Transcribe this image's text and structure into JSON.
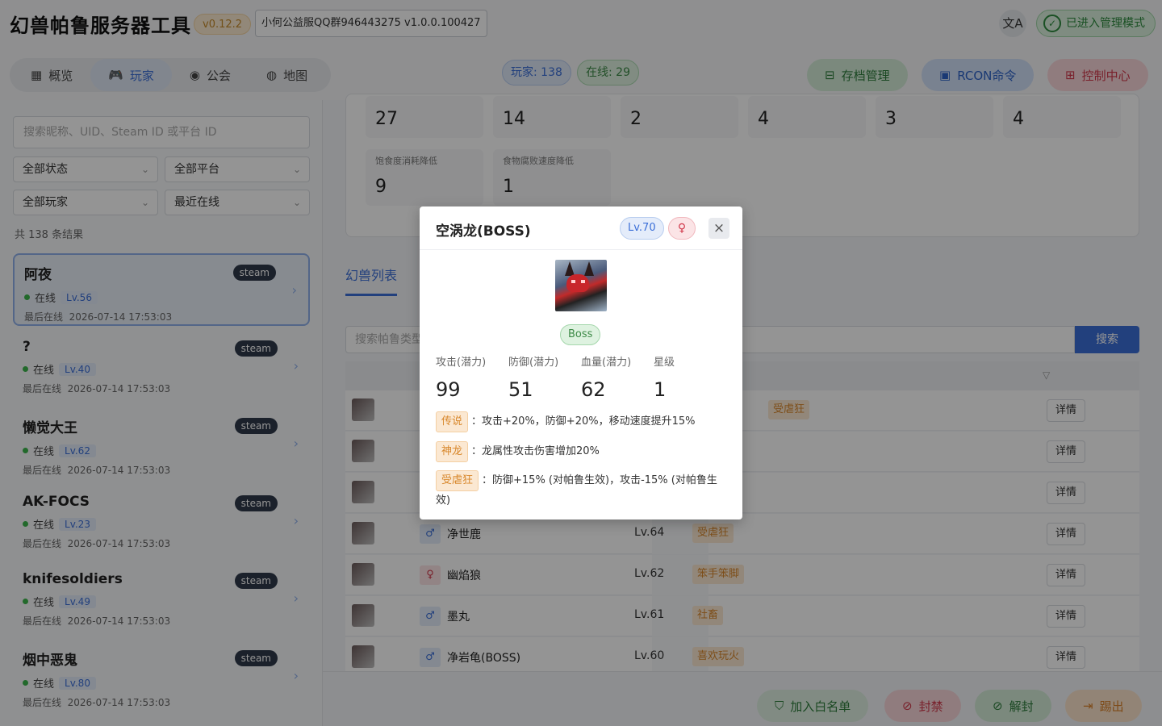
{
  "app": {
    "title": "幻兽帕鲁服务器工具",
    "version": "v0.12.2",
    "group_tag": "小何公益服QQ群946443275 v1.0.0.100427",
    "translate_glyph": "文A",
    "admin_mode": "已进入管理模式"
  },
  "nav": {
    "tabs": [
      {
        "icon": "▦",
        "label": "概览"
      },
      {
        "icon": "🎮",
        "label": "玩家"
      },
      {
        "icon": "◉",
        "label": "公会"
      },
      {
        "icon": "◍",
        "label": "地图"
      }
    ],
    "active_tab": "玩家"
  },
  "stats": {
    "players": "玩家: 138",
    "online": "在线: 29"
  },
  "toolbar": {
    "save": "存档管理",
    "rcon": "RCON命令",
    "control": "控制中心"
  },
  "sidebar": {
    "search_placeholder": "搜索昵称、UID、Steam ID 或平台 ID",
    "filters": {
      "status": "全部状态",
      "platform": "全部平台",
      "players": "全部玩家",
      "sort": "最近在线"
    },
    "result_count": "共 138 条结果",
    "players": [
      {
        "name": "阿夜",
        "platform": "steam",
        "status": "在线",
        "level": "Lv.56",
        "last_label": "最后在线",
        "last": "2026-07-14 17:53:03"
      },
      {
        "name": "?",
        "platform": "steam",
        "status": "在线",
        "level": "Lv.40",
        "last_label": "最后在线",
        "last": "2026-07-14 17:53:03"
      },
      {
        "name": "懒觉大王",
        "platform": "steam",
        "status": "在线",
        "level": "Lv.62",
        "last_label": "最后在线",
        "last": "2026-07-14 17:53:03"
      },
      {
        "name": "AK-FOCS",
        "platform": "steam",
        "status": "在线",
        "level": "Lv.23",
        "last_label": "最后在线",
        "last": "2026-07-14 17:53:03"
      },
      {
        "name": "knifesoldiers",
        "platform": "steam",
        "status": "在线",
        "level": "Lv.49",
        "last_label": "最后在线",
        "last": "2026-07-14 17:53:03"
      },
      {
        "name": "烟中恶鬼",
        "platform": "steam",
        "status": "在线",
        "level": "Lv.80",
        "last_label": "最后在线",
        "last": "2026-07-14 17:53:03"
      }
    ]
  },
  "main": {
    "stat_values": [
      "27",
      "14",
      "2",
      "4",
      "3",
      "4"
    ],
    "stat_cells2": [
      {
        "label": "饱食度消耗降低",
        "value": "9"
      },
      {
        "label": "食物腐败速度降低",
        "value": "1"
      }
    ],
    "tab_label": "幻兽列表",
    "pal_search_placeholder": "搜索帕鲁类型",
    "search_button": "搜索",
    "rows": [
      {
        "gender": "",
        "name": "",
        "level": "",
        "trait": "受虐狂",
        "detail": "详情"
      },
      {
        "gender": "",
        "name": "",
        "level": "",
        "trait": "",
        "detail": "详情"
      },
      {
        "gender": "",
        "name": "",
        "level": "",
        "trait": "",
        "detail": "详情"
      },
      {
        "gender": "♂",
        "name": "净世鹿",
        "level": "Lv.64",
        "trait": "受虐狂",
        "detail": "详情"
      },
      {
        "gender": "♀",
        "name": "幽焰狼",
        "level": "Lv.62",
        "trait": "笨手笨脚",
        "detail": "详情"
      },
      {
        "gender": "♂",
        "name": "墨丸",
        "level": "Lv.61",
        "trait": "社畜",
        "detail": "详情"
      },
      {
        "gender": "♂",
        "name": "净岩龟(BOSS)",
        "level": "Lv.60",
        "trait": "喜欢玩火",
        "detail": "详情"
      }
    ],
    "actions": {
      "whitelist": "加入白名单",
      "ban": "封禁",
      "unban": "解封",
      "kick": "踢出"
    }
  },
  "modal": {
    "title": "空涡龙(BOSS)",
    "level": "Lv.70",
    "gender": "♀",
    "close": "×",
    "badge": "Boss",
    "stats": [
      {
        "label": "攻击(潜力)",
        "value": "99"
      },
      {
        "label": "防御(潜力)",
        "value": "51"
      },
      {
        "label": "血量(潜力)",
        "value": "62"
      },
      {
        "label": "星级",
        "value": "1"
      }
    ],
    "passives": [
      {
        "name": "传说",
        "desc": "：攻击+20%，防御+20%，移动速度提升15%"
      },
      {
        "name": "神龙",
        "desc": "：龙属性攻击伤害增加20%"
      },
      {
        "name": "受虐狂",
        "desc": "：防御+15% (对帕鲁生效)，攻击-15% (对帕鲁生效)"
      }
    ]
  }
}
